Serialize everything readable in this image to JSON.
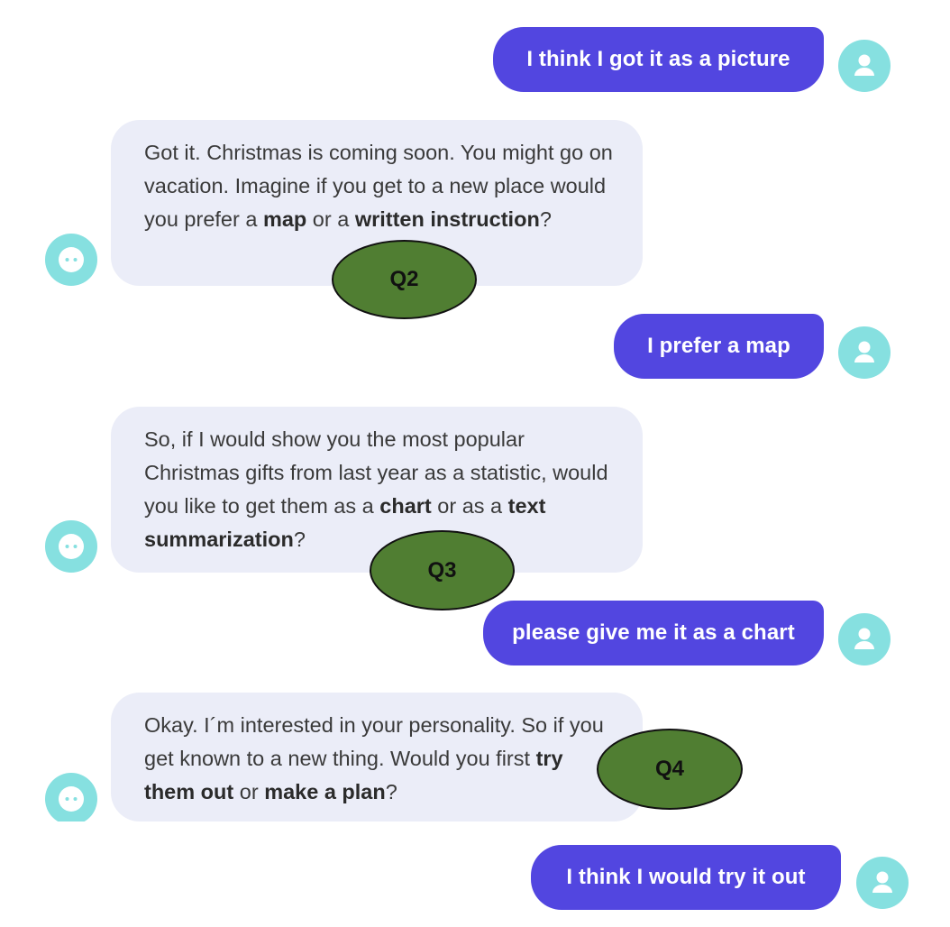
{
  "colors": {
    "user_bubble": "#5246e0",
    "bot_bubble": "#ebedf8",
    "avatar": "#86e0e0",
    "badge": "#507e32"
  },
  "icons": {
    "user_avatar": "user-icon",
    "bot_avatar": "bot-icon"
  },
  "messages": [
    {
      "sender": "user",
      "text": "I think I got it as a picture"
    },
    {
      "sender": "bot",
      "parts": [
        "Got it. Christmas is coming soon. You might go on vacation. Imagine if you get to a new place would you prefer a ",
        "map",
        " or a ",
        "written instruction",
        "?"
      ]
    },
    {
      "sender": "user",
      "text": "I prefer a map"
    },
    {
      "sender": "bot",
      "parts": [
        "So, if I would show you the most popular Christmas gifts from last year as a statistic, would you like to get them as a ",
        "chart",
        " or as a ",
        "text summarization",
        "?"
      ]
    },
    {
      "sender": "user",
      "text": "please give me it as a chart"
    },
    {
      "sender": "bot",
      "parts": [
        "Okay. I´m interested in your personality. So if you get known to a new thing. Would you first ",
        "try them out",
        " or ",
        "make a plan",
        "?"
      ]
    },
    {
      "sender": "user",
      "text": "I think I would try it out"
    }
  ],
  "badges": [
    "Q2",
    "Q3",
    "Q4"
  ]
}
